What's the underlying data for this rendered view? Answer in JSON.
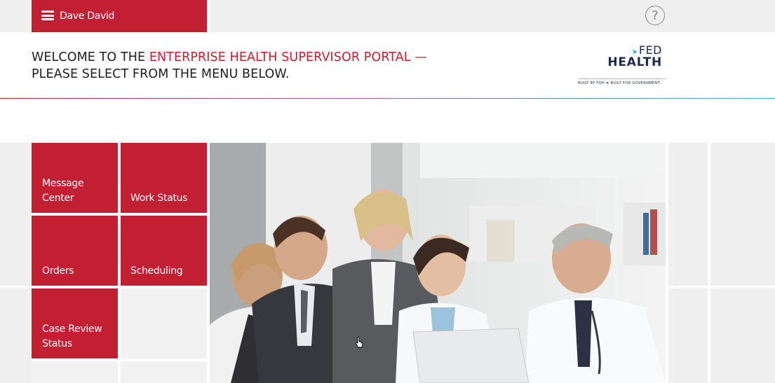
{
  "user": {
    "name": "Dave David"
  },
  "help": {
    "symbol": "?"
  },
  "header": {
    "welcome_prefix": "WELCOME TO THE ",
    "welcome_highlight": "ENTERPRISE HEALTH SUPERVISOR PORTAL —",
    "welcome_line2": "PLEASE SELECT FROM THE MENU BELOW."
  },
  "logo": {
    "fed": "FED",
    "health": "HEALTH",
    "tagline": "BUILT BY FOH ➤ BUILT FOR GOVERNMENT."
  },
  "menu": {
    "tiles": [
      {
        "label": "Message Center"
      },
      {
        "label": "Work Status"
      },
      {
        "label": "Orders"
      },
      {
        "label": "Scheduling"
      },
      {
        "label": "Case Review Status"
      }
    ]
  },
  "colors": {
    "brand_red": "#c21f32",
    "tile_gray": "#f1f1f1",
    "page_gray": "#efefef",
    "logo_navy": "#1d2c4c",
    "accent_teal": "#3bb0ba"
  },
  "icons": {
    "menu": "hamburger-menu-icon",
    "help": "question-circle-icon",
    "cursor": "hand-pointer-cursor"
  },
  "photo": {
    "subject": "team of medical staff and business people around a laptop"
  }
}
